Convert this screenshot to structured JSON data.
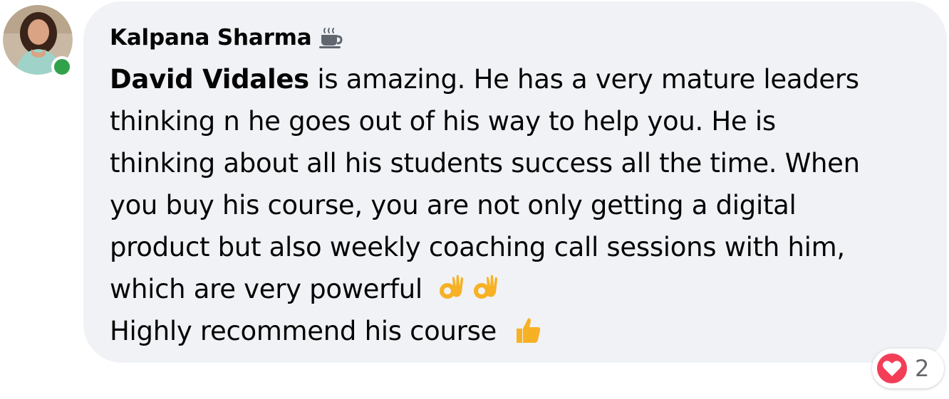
{
  "comment": {
    "author": "Kalpana Sharma",
    "author_badge_icon": "coffee-cup-icon",
    "online": true,
    "mention": "David Vidales",
    "text_lines": [
      " is amazing. He has a very mature leaders",
      "thinking n he goes out of his way to help you. He is",
      "thinking about all his students success all the time. When",
      "you buy his course, you are not only getting a digital",
      "product but also weekly coaching call sessions with him,",
      "which are very powerful",
      "Highly recommend his course"
    ],
    "emojis": {
      "line6": [
        "ok-hand-icon",
        "ok-hand-icon"
      ],
      "line7": [
        "thumbs-up-icon"
      ]
    },
    "reactions": {
      "icon": "heart-reaction-icon",
      "count": "2"
    }
  },
  "colors": {
    "bubble_bg": "#f0f2f5",
    "presence_green": "#31a24c",
    "love_red": "#f33e58",
    "emoji_yellow": "#f7b125",
    "meta_gray": "#65676b"
  }
}
